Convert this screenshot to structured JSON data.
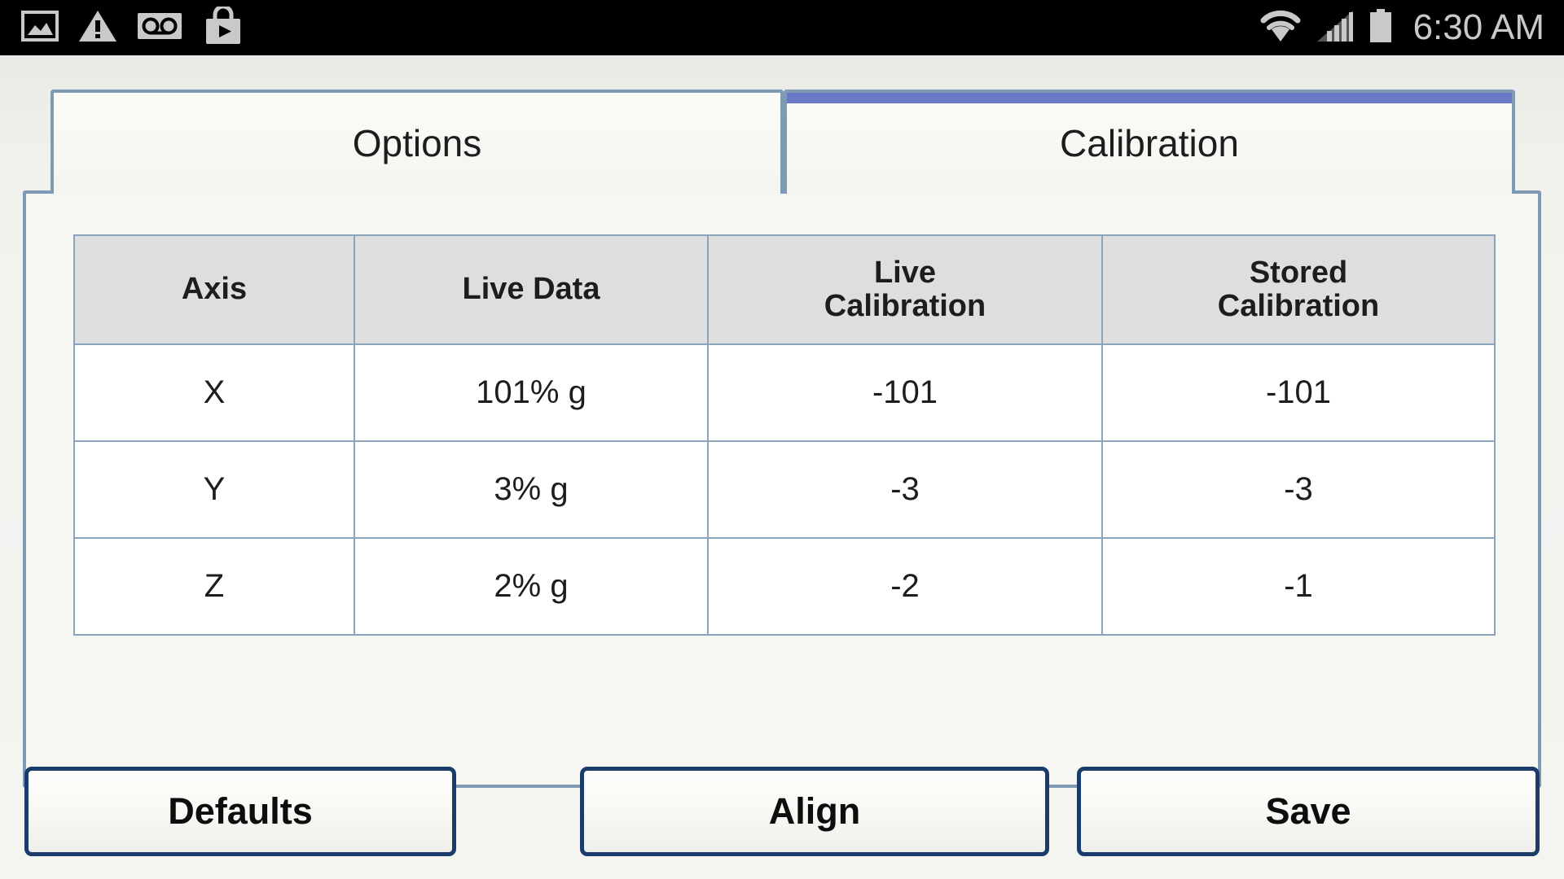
{
  "statusbar": {
    "time": "6:30 AM",
    "left_icons": [
      {
        "name": "screenshot-icon",
        "label": "screenshot"
      },
      {
        "name": "warning-icon",
        "label": "warning"
      },
      {
        "name": "voicemail-icon",
        "label": "voicemail"
      },
      {
        "name": "play-store-icon",
        "label": "play-store"
      }
    ],
    "right_icons": [
      {
        "name": "wifi-icon",
        "label": "wifi"
      },
      {
        "name": "cellular-signal-icon",
        "label": "signal"
      },
      {
        "name": "battery-icon",
        "label": "battery"
      }
    ]
  },
  "tabs": [
    {
      "id": "options",
      "label": "Options",
      "active": false
    },
    {
      "id": "calibration",
      "label": "Calibration",
      "active": true
    }
  ],
  "table": {
    "headers": [
      {
        "line1": "Axis",
        "line2": ""
      },
      {
        "line1": "Live Data",
        "line2": ""
      },
      {
        "line1": "Live",
        "line2": "Calibration"
      },
      {
        "line1": "Stored",
        "line2": "Calibration"
      }
    ],
    "rows": [
      {
        "axis": "X",
        "live_data": "101% g",
        "live_calibration": "-101",
        "stored_calibration": "-101"
      },
      {
        "axis": "Y",
        "live_data": "3% g",
        "live_calibration": "-3",
        "stored_calibration": "-3"
      },
      {
        "axis": "Z",
        "live_data": "2% g",
        "live_calibration": "-2",
        "stored_calibration": "-1"
      }
    ]
  },
  "buttons": [
    {
      "id": "defaults",
      "label": "Defaults"
    },
    {
      "id": "align",
      "label": "Align"
    },
    {
      "id": "save",
      "label": "Save"
    }
  ],
  "colors": {
    "statusbar_bg": "#000000",
    "statusbar_fg": "#c9c9c9",
    "tab_border": "#7e9ab5",
    "tab_active_accent": "#6a79c7",
    "panel_bg": "#f6f6f2",
    "table_header_bg": "#dedede",
    "table_border": "#8aa4bd",
    "button_border": "#1a3c6b"
  }
}
